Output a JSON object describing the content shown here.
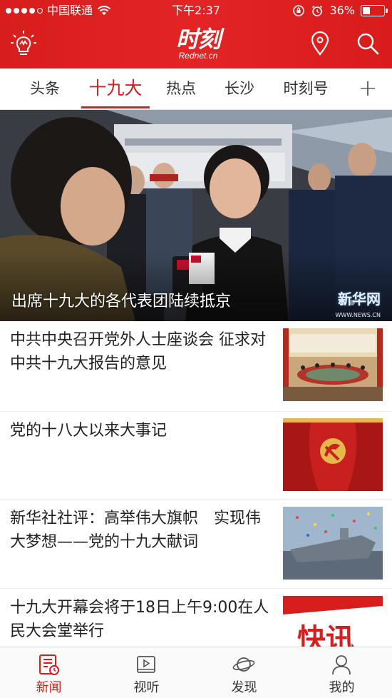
{
  "status_bar": {
    "carrier": "中国联通",
    "time": "下午2:37",
    "battery_percent": "36%",
    "battery_level": 0.36
  },
  "app_bar": {
    "logo_text": "时刻",
    "logo_sub": "Rednet.cn"
  },
  "tabs": [
    {
      "label": "头条"
    },
    {
      "label": "十九大"
    },
    {
      "label": "热点"
    },
    {
      "label": "长沙"
    },
    {
      "label": "时刻号"
    }
  ],
  "active_tab": "十九大",
  "add_tab_symbol": "+",
  "hero": {
    "caption": "出席十九大的各代表团陆续抵京",
    "watermark": "新华网",
    "watermark_sub": "WWW.NEWS.CN",
    "slide_count": 2,
    "active_slide": 1
  },
  "news": [
    {
      "title": "中共中央召开党外人士座谈会 征求对中共十九大报告的意见",
      "thumb": "meeting-hall-photo"
    },
    {
      "title": "党的十八大以来大事记",
      "thumb": "party-emblem-photo"
    },
    {
      "title": "新华社社评：高举伟大旗帜　实现伟大梦想——党的十九大献词",
      "thumb": "aircraft-carrier-photo"
    },
    {
      "title": "十九大开幕会将于18日上午9:00在人民大会堂举行",
      "thumb_text": "快讯"
    }
  ],
  "bottom_nav": [
    {
      "label": "新闻",
      "icon": "news-icon",
      "active": true
    },
    {
      "label": "视听",
      "icon": "video-icon",
      "active": false
    },
    {
      "label": "发现",
      "icon": "discover-icon",
      "active": false
    },
    {
      "label": "我的",
      "icon": "profile-icon",
      "active": false
    }
  ],
  "colors": {
    "brand_red": "#d81d1d",
    "text": "#222222"
  }
}
